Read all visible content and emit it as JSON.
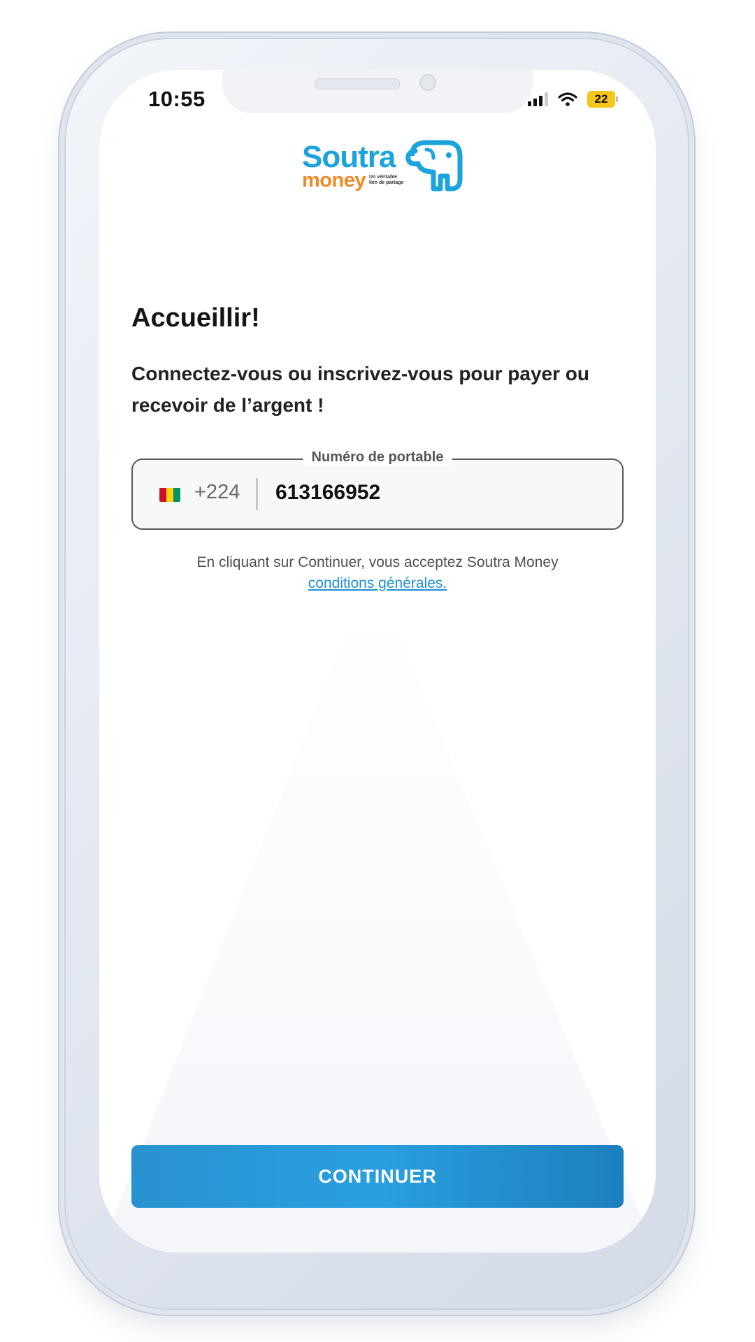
{
  "status_bar": {
    "time": "10:55",
    "battery": "22",
    "signal_icon": "cellular-signal-icon",
    "wifi_icon": "wifi-icon"
  },
  "logo": {
    "brand": "Soutra",
    "brand_sub": "money",
    "tagline_line1": "Un véritable",
    "tagline_line2": "lien de partage",
    "brand_color": "#1aa3dc",
    "accent_color": "#f08a24"
  },
  "welcome": {
    "title": "Accueillir!",
    "subtitle": "Connectez-vous ou inscrivez-vous pour payer ou recevoir de l’argent !"
  },
  "phone_field": {
    "label": "Numéro de portable",
    "country_flag": "guinea-flag-icon",
    "country_code": "+224",
    "value": "613166952"
  },
  "terms": {
    "text": "En cliquant sur Continuer, vous acceptez Soutra Money",
    "link": "conditions générales."
  },
  "actions": {
    "continue_label": "CONTINUER",
    "button_color": "#2892d0"
  }
}
